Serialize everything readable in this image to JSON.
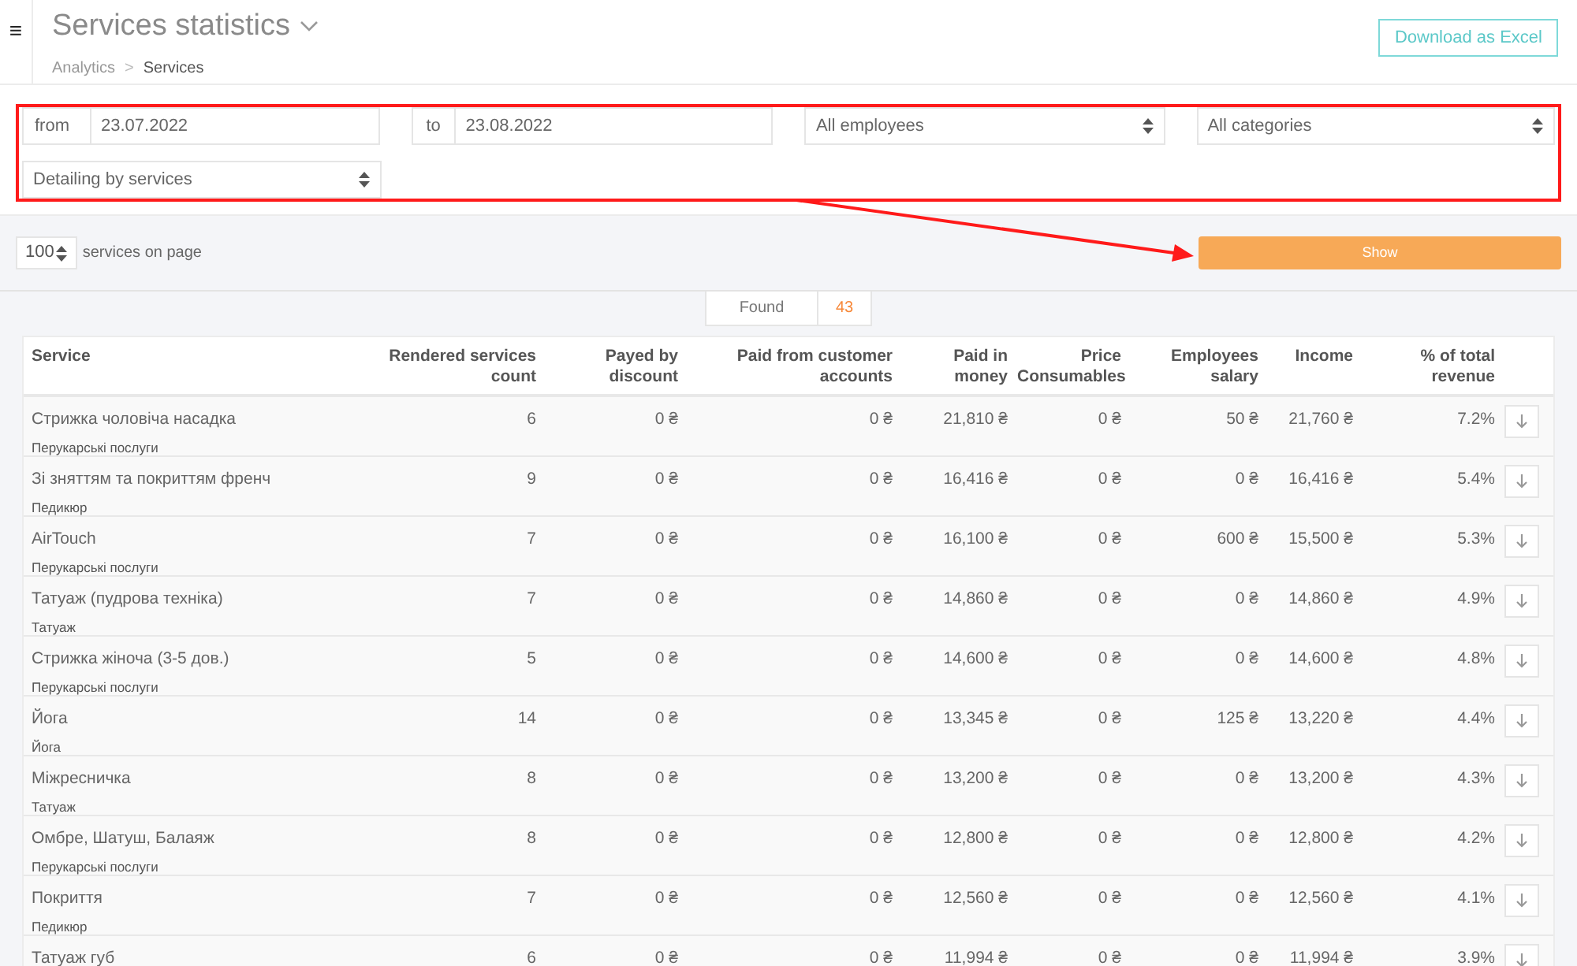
{
  "header": {
    "menu_icon": "≡",
    "title": "Services statistics",
    "breadcrumbs": [
      {
        "label": "Analytics",
        "current": false
      },
      {
        "label": "Services",
        "current": true
      }
    ],
    "separator": ">",
    "download_button": "Download as Excel"
  },
  "filters": {
    "from_label": "from",
    "from_value": "23.07.2022",
    "to_label": "to",
    "to_value": "23.08.2022",
    "employees": "All employees",
    "categories": "All categories",
    "detailing": "Detailing by services"
  },
  "paging": {
    "per_page": "100",
    "per_page_label": "services on page",
    "show_button": "Show"
  },
  "found": {
    "label": "Found",
    "count": "43"
  },
  "table": {
    "columns": [
      "Service",
      "Rendered services count",
      "Payed by discount",
      "Paid from customer accounts",
      "Paid in money",
      "Price Consumables",
      "Employees salary",
      "Income",
      "% of total revenue"
    ],
    "rows": [
      {
        "name": "Стрижка чоловіча насадка",
        "category": "Перукарські послуги",
        "values": [
          "6",
          "0 ₴",
          "0 ₴",
          "21,810 ₴",
          "0 ₴",
          "50 ₴",
          "21,760 ₴",
          "7.2%"
        ]
      },
      {
        "name": "Зі зняттям та покриттям френч",
        "category": "Педикюр",
        "values": [
          "9",
          "0 ₴",
          "0 ₴",
          "16,416 ₴",
          "0 ₴",
          "0 ₴",
          "16,416 ₴",
          "5.4%"
        ]
      },
      {
        "name": "AirTouch",
        "category": "Перукарські послуги",
        "values": [
          "7",
          "0 ₴",
          "0 ₴",
          "16,100 ₴",
          "0 ₴",
          "600 ₴",
          "15,500 ₴",
          "5.3%"
        ]
      },
      {
        "name": "Татуаж (пудрова техніка)",
        "category": "Татуаж",
        "values": [
          "7",
          "0 ₴",
          "0 ₴",
          "14,860 ₴",
          "0 ₴",
          "0 ₴",
          "14,860 ₴",
          "4.9%"
        ]
      },
      {
        "name": "Стрижка жіноча (3-5 дов.)",
        "category": "Перукарські послуги",
        "values": [
          "5",
          "0 ₴",
          "0 ₴",
          "14,600 ₴",
          "0 ₴",
          "0 ₴",
          "14,600 ₴",
          "4.8%"
        ]
      },
      {
        "name": "Йога",
        "category": "Йога",
        "values": [
          "14",
          "0 ₴",
          "0 ₴",
          "13,345 ₴",
          "0 ₴",
          "125 ₴",
          "13,220 ₴",
          "4.4%"
        ]
      },
      {
        "name": "Міжресничка",
        "category": "Татуаж",
        "values": [
          "8",
          "0 ₴",
          "0 ₴",
          "13,200 ₴",
          "0 ₴",
          "0 ₴",
          "13,200 ₴",
          "4.3%"
        ]
      },
      {
        "name": "Омбре, Шатуш, Балаяж",
        "category": "Перукарські послуги",
        "values": [
          "8",
          "0 ₴",
          "0 ₴",
          "12,800 ₴",
          "0 ₴",
          "0 ₴",
          "12,800 ₴",
          "4.2%"
        ]
      },
      {
        "name": "Покриття",
        "category": "Педикюр",
        "values": [
          "7",
          "0 ₴",
          "0 ₴",
          "12,560 ₴",
          "0 ₴",
          "0 ₴",
          "12,560 ₴",
          "4.1%"
        ]
      },
      {
        "name": "Татуаж губ",
        "values": [
          "6",
          "0 ₴",
          "0 ₴",
          "11,994 ₴",
          "0 ₴",
          "0 ₴",
          "11,994 ₴",
          "3.9%"
        ]
      }
    ]
  }
}
